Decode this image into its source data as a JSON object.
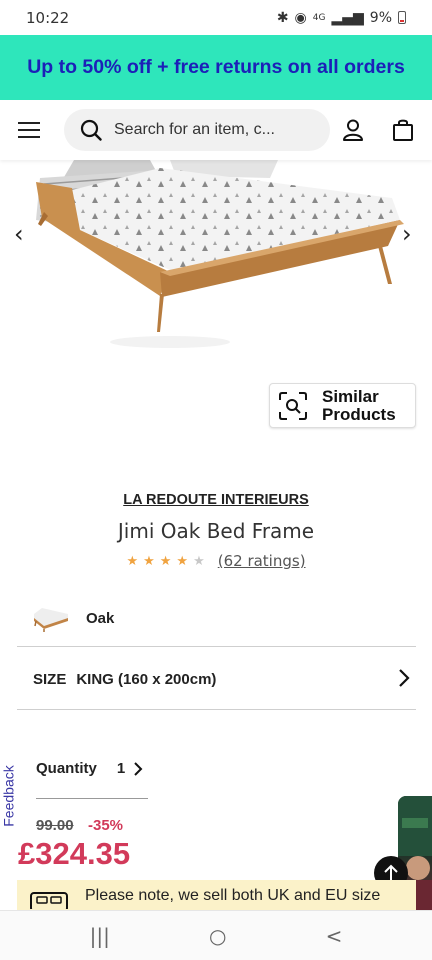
{
  "status_bar": {
    "time": "10:22",
    "battery": "9%",
    "network": "4G"
  },
  "promo": {
    "text": "Up to 50% off + free returns on all orders",
    "background": "#2ee6bb",
    "color": "#1c20b8"
  },
  "header": {
    "search_placeholder": "Search for an item, c..."
  },
  "gallery": {
    "similar_line1": "Similar",
    "similar_line2": "Products"
  },
  "product": {
    "brand": "LA REDOUTE INTERIEURS",
    "title": "Jimi Oak Bed Frame",
    "rating_stars": 4,
    "rating_max": 5,
    "rating_text": "(62 ratings)",
    "colour": "Oak",
    "size_label": "SIZE",
    "size_value": "KING (160 x 200cm)",
    "quantity_label": "Quantity",
    "quantity_value": "1",
    "old_price": "99.00",
    "discount": "-35%",
    "price": "£324.35",
    "price_color": "#d23a5a"
  },
  "feedback_label": "Feedback",
  "notice": {
    "text": "Please note, we sell both UK and EU size"
  },
  "nav": {
    "recents": "|||",
    "home": "○",
    "back": "<"
  }
}
